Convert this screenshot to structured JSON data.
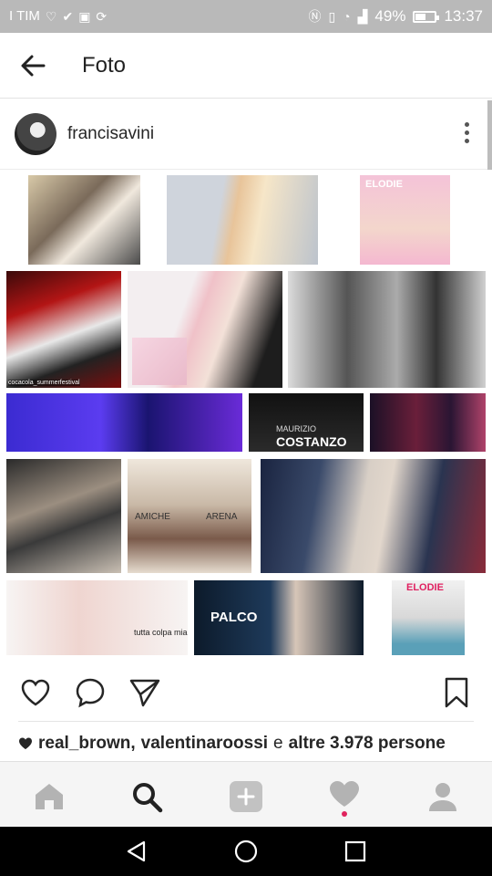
{
  "status_bar": {
    "carrier": "I TIM",
    "battery_percent": "49%",
    "time": "13:37",
    "icons": [
      "heart-pulse-icon",
      "download-done-icon",
      "photo-icon",
      "sync-icon",
      "nfc-icon",
      "vibrate-icon",
      "wifi-icon",
      "signal-icon",
      "battery-icon"
    ]
  },
  "app_bar": {
    "back_icon": "arrow-left-icon",
    "title": "Foto"
  },
  "post": {
    "username": "francisavini",
    "more_icon": "more-vertical-icon",
    "collage_captions": {
      "elodie_top": "ELODIE",
      "festival": "cocacola_summerfestival",
      "costanzo_line1": "MAURIZIO",
      "costanzo_line2": "COSTANZO",
      "amici_left": "AMICHE",
      "amici_right": "ARENA",
      "tutta": "tutta colpa mia",
      "palco": "PALCO",
      "elodie_bottom": "ELODIE"
    }
  },
  "actions": {
    "like_icon": "heart-outline-icon",
    "comment_icon": "comment-icon",
    "share_icon": "paper-plane-icon",
    "save_icon": "bookmark-icon"
  },
  "likes": {
    "heart_icon": "heart-filled-icon",
    "user1": "real_brown",
    "separator": ",",
    "user2": "valentinaroossi",
    "conjunction": "e",
    "others": "altre 3.978 persone"
  },
  "bottom_nav": {
    "items": [
      "home-icon",
      "search-icon",
      "add-icon",
      "activity-heart-icon",
      "profile-icon"
    ],
    "active": "search-icon",
    "accent": "#e0245e"
  },
  "system_nav": {
    "items": [
      "back-triangle-icon",
      "home-circle-icon",
      "recents-square-icon"
    ]
  }
}
